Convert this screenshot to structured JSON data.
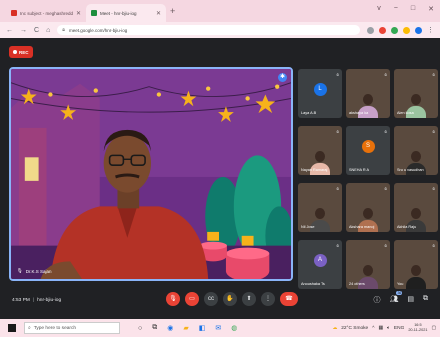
{
  "browser": {
    "tabs": [
      {
        "title": "Inc subject - meghashreddy",
        "color": "#d93025",
        "active": false
      },
      {
        "title": "Meet - hnr-bjiu-iog",
        "color": "#1e8e3e",
        "active": true
      }
    ],
    "new_tab": "+",
    "window_buttons": [
      "v",
      "−",
      "□",
      "✕"
    ],
    "nav": {
      "back": "←",
      "forward": "→",
      "reload": "C",
      "home": "⌂"
    },
    "url": "meet.google.com/hnr-bjiu-iog"
  },
  "meet": {
    "rec_label": "REC",
    "presenter": {
      "name": "Dr.K.S Sajan"
    },
    "participants": [
      {
        "name": "Laya A.B",
        "initial": "L",
        "avatar_color": "#1a73e8",
        "video": false
      },
      {
        "name": "akshaya ka",
        "initial": "",
        "avatar_color": "",
        "video": true,
        "shirt": "#c7a0c8"
      },
      {
        "name": "Alen kosa",
        "initial": "",
        "avatar_color": "",
        "video": true,
        "shirt": "#9bc4a0"
      },
      {
        "name": "Nayan Ramaraj",
        "initial": "",
        "avatar_color": "",
        "video": true,
        "shirt": "#e7b8a8"
      },
      {
        "name": "SNEHA R A",
        "initial": "S",
        "avatar_color": "#e8710a",
        "video": false
      },
      {
        "name": "Sru u vasudhan",
        "initial": "",
        "avatar_color": "",
        "video": true,
        "shirt": "#2a2a2a"
      },
      {
        "name": "Nil Jose",
        "initial": "",
        "avatar_color": "",
        "video": true,
        "shirt": "#4a4a4a"
      },
      {
        "name": "Akshara manoj",
        "initial": "",
        "avatar_color": "",
        "video": true,
        "shirt": "#b07050"
      },
      {
        "name": "Akhila Raju",
        "initial": "",
        "avatar_color": "",
        "video": true,
        "shirt": "#3a3a3a"
      },
      {
        "name": "Anoushaka Ts",
        "initial": "A",
        "avatar_color": "#7b61c4",
        "video": false
      },
      {
        "name": "24 others",
        "initial": "",
        "avatar_color": "",
        "video": true,
        "shirt": "#6b4a6b"
      },
      {
        "name": "You",
        "initial": "",
        "avatar_color": "",
        "video": true,
        "shirt": "#1f1f1f"
      }
    ],
    "time": "4:53 PM",
    "meeting_code": "hnr-bjiu-iog",
    "controls": {
      "mic": "mic-off-icon",
      "camera": "camera-off-icon",
      "captions": "cc",
      "raise_hand": "✋",
      "present": "present-icon",
      "more": "⋮",
      "end": "end-call-icon"
    },
    "right_controls": {
      "info": "ⓘ",
      "people": "people-icon",
      "people_count": "36",
      "chat": "chat-icon",
      "activities": "activities-icon"
    }
  },
  "taskbar": {
    "search_placeholder": "Type here to search",
    "weather": "22°C Smoke",
    "time": "16:5",
    "date": "20-11-2021"
  }
}
